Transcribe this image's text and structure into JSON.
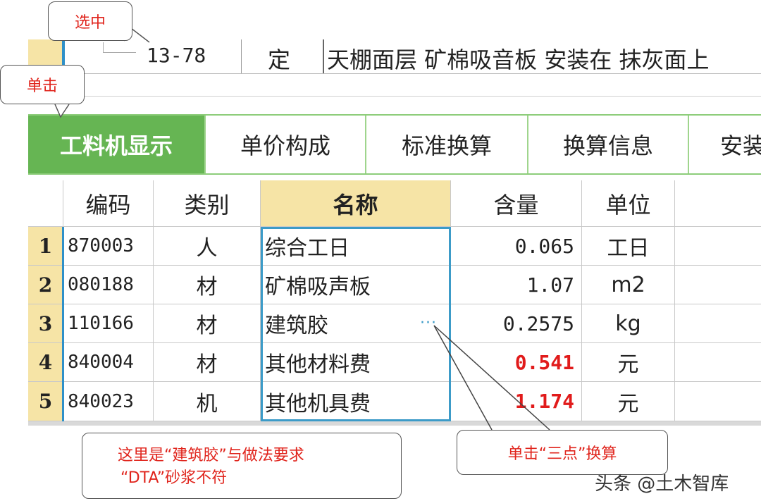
{
  "quota_row": {
    "code": "13-78",
    "type": "定",
    "name": "天棚面层 矿棉吸音板 安装在 抹灰面上"
  },
  "tabs": [
    {
      "label": "工料机显示",
      "active": true
    },
    {
      "label": "单价构成",
      "active": false
    },
    {
      "label": "标准换算",
      "active": false
    },
    {
      "label": "换算信息",
      "active": false
    },
    {
      "label": "安装",
      "active": false
    }
  ],
  "grid": {
    "headers": {
      "code": "编码",
      "category": "类别",
      "name": "名称",
      "quantity": "含量",
      "unit": "单位"
    },
    "rows": [
      {
        "num": "1",
        "code": "870003",
        "category": "人",
        "name": "综合工日",
        "quantity": "0.065",
        "unit": "工日",
        "highlight": false
      },
      {
        "num": "2",
        "code": "080188",
        "category": "材",
        "name": "矿棉吸声板",
        "quantity": "1.07",
        "unit": "m2",
        "highlight": false
      },
      {
        "num": "3",
        "code": "110166",
        "category": "材",
        "name": "建筑胶",
        "quantity": "0.2575",
        "unit": "kg",
        "highlight": false
      },
      {
        "num": "4",
        "code": "840004",
        "category": "材",
        "name": "其他材料费",
        "quantity": "0.541",
        "unit": "元",
        "highlight": true
      },
      {
        "num": "5",
        "code": "840023",
        "category": "机",
        "name": "其他机具费",
        "quantity": "1.174",
        "unit": "元",
        "highlight": true
      }
    ],
    "ellipsis": "···"
  },
  "callouts": {
    "select": "选中",
    "click": "单击",
    "note_line1": "这里是“建筑胶”与做法要求",
    "note_line2": "“DTA”砂浆不符",
    "three_dots": "单击“三点”换算"
  },
  "watermark": "头条 @土木智库",
  "colors": {
    "tab_active": "#66b553",
    "header_yellow": "#f6e4a6",
    "selection_blue": "#3c9bc8",
    "highlight_red": "#e11b1b",
    "callout_text": "#e0241c"
  }
}
